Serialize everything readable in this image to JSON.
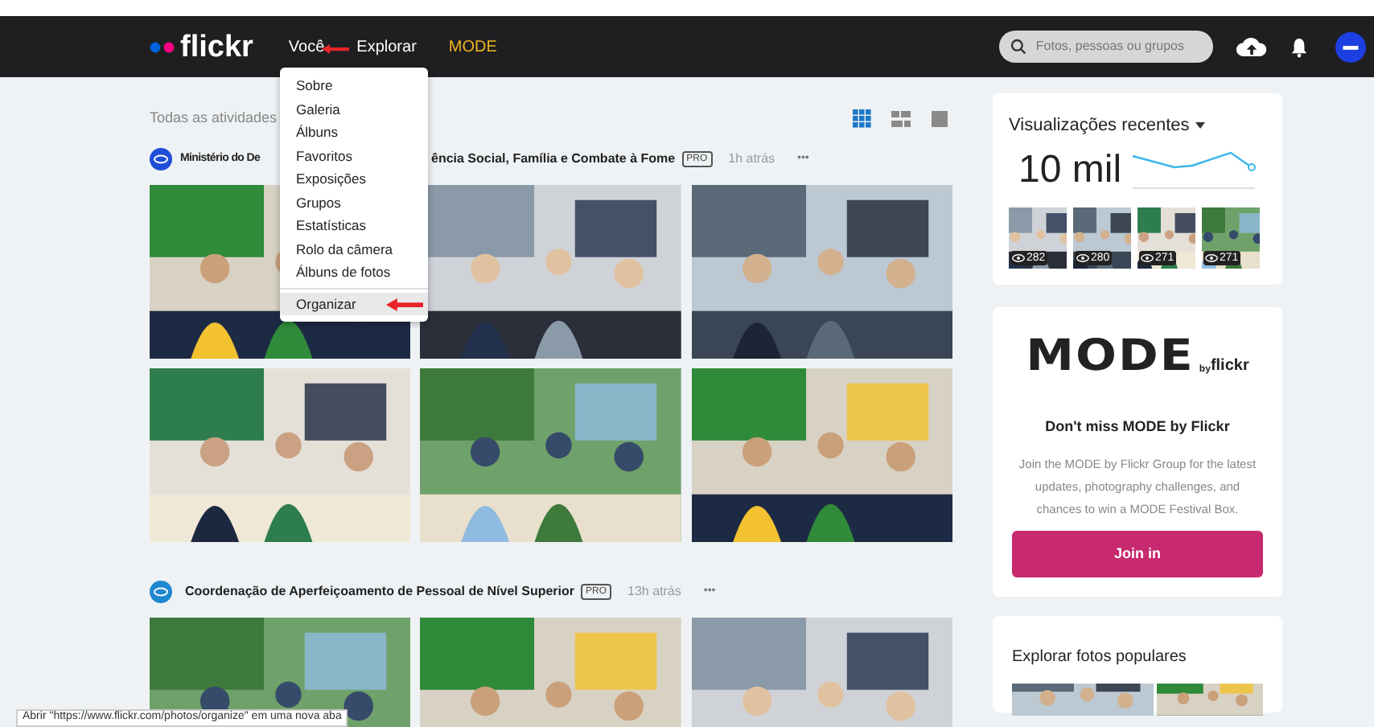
{
  "nav": {
    "logo": "flickr",
    "links": [
      {
        "label": "Você",
        "kind": "plain"
      },
      {
        "label": "Explorar",
        "kind": "plain"
      },
      {
        "label": "MODE",
        "kind": "highlight"
      }
    ],
    "search": {
      "placeholder": "Fotos, pessoas ou grupos"
    }
  },
  "menu": {
    "items": [
      {
        "label": "Sobre",
        "selected": false
      },
      {
        "label": "Galeria",
        "selected": false
      },
      {
        "label": "Álbuns",
        "selected": false
      },
      {
        "label": "Favoritos",
        "selected": false
      },
      {
        "label": "Exposições",
        "selected": false
      },
      {
        "label": "Grupos",
        "selected": false
      },
      {
        "label": "Estatísticas",
        "selected": false
      },
      {
        "label": "Rolo da câmera",
        "selected": false
      },
      {
        "label": "Álbuns de fotos",
        "selected": false
      },
      {
        "label": "Organizar",
        "selected": true
      }
    ]
  },
  "feed": {
    "title": "Todas as atividades",
    "views": [
      {
        "kind": "grid",
        "selected": true
      },
      {
        "kind": "justified",
        "selected": false
      },
      {
        "kind": "single",
        "selected": false
      }
    ],
    "posts": [
      {
        "author_start": "Ministério do De",
        "author_end": "ência Social, Família e Combate à Fome",
        "badge": "PRO",
        "time": "1h atrás",
        "more": "•••"
      },
      {
        "author_start": "Coordenação de Aperfeiçoamento de Pessoal de Nível Superior",
        "badge": "PRO",
        "time": "13h atrás",
        "more": "•••"
      }
    ]
  },
  "recent_views": {
    "title": "Visualizações recentes",
    "total": "10 mil",
    "thumbs": [
      {
        "count": "282"
      },
      {
        "count": "280"
      },
      {
        "count": "271"
      },
      {
        "count": "271"
      }
    ]
  },
  "mode_card": {
    "logo": "MODE",
    "logo_by": "by",
    "logo_brand": "flickr",
    "heading": "Don't miss MODE by Flickr",
    "body": "Join the MODE by Flickr Group for the latest updates, photography challenges, and chances to win a MODE Festival Box.",
    "button": "Join in"
  },
  "popular": {
    "title": "Explorar fotos populares"
  },
  "status_bar": {
    "text": "Abrir \"https://www.flickr.com/photos/organize\" em uma nova aba"
  }
}
